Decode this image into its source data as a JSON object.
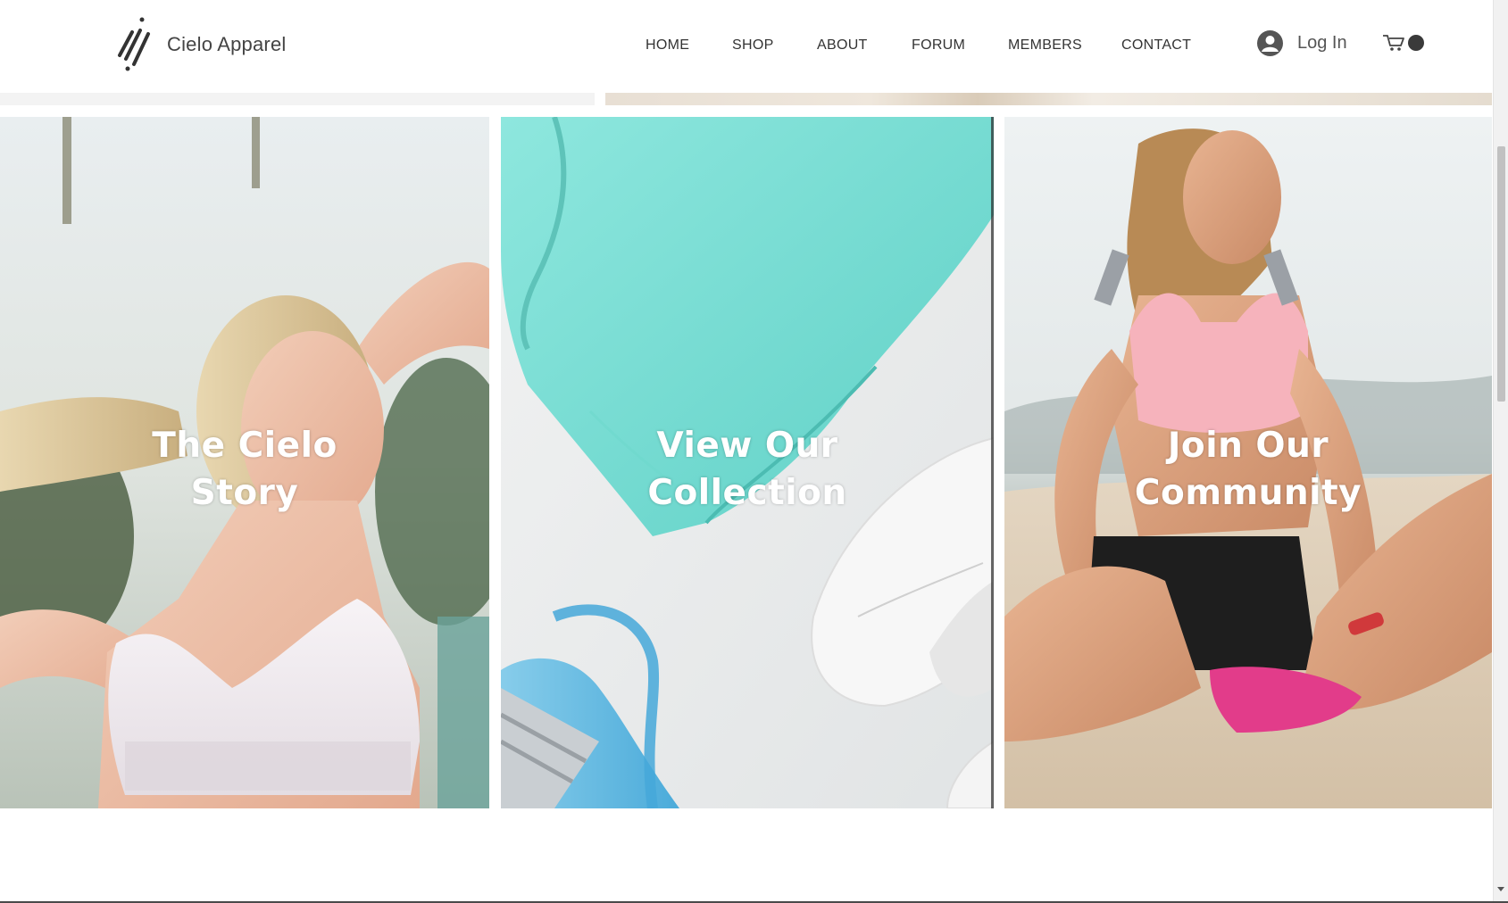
{
  "header": {
    "brand_name": "Cielo Apparel",
    "nav": [
      {
        "label": "HOME"
      },
      {
        "label": "SHOP"
      },
      {
        "label": "ABOUT"
      },
      {
        "label": "FORUM"
      },
      {
        "label": "MEMBERS"
      },
      {
        "label": "CONTACT"
      }
    ],
    "login_label": "Log In",
    "icons": {
      "logo": "slashes-logo-icon",
      "avatar": "user-avatar-icon",
      "cart": "shopping-cart-icon"
    }
  },
  "panels": [
    {
      "line1": "The Cielo",
      "line2": "Story"
    },
    {
      "line1": "View Our",
      "line2": "Collection"
    },
    {
      "line1": "Join Our",
      "line2": "Community"
    }
  ],
  "colors": {
    "text_dark": "#333333",
    "panel_text": "#ffffff",
    "mint": "#7fe0d6",
    "pink_top": "#f7b5bd"
  }
}
